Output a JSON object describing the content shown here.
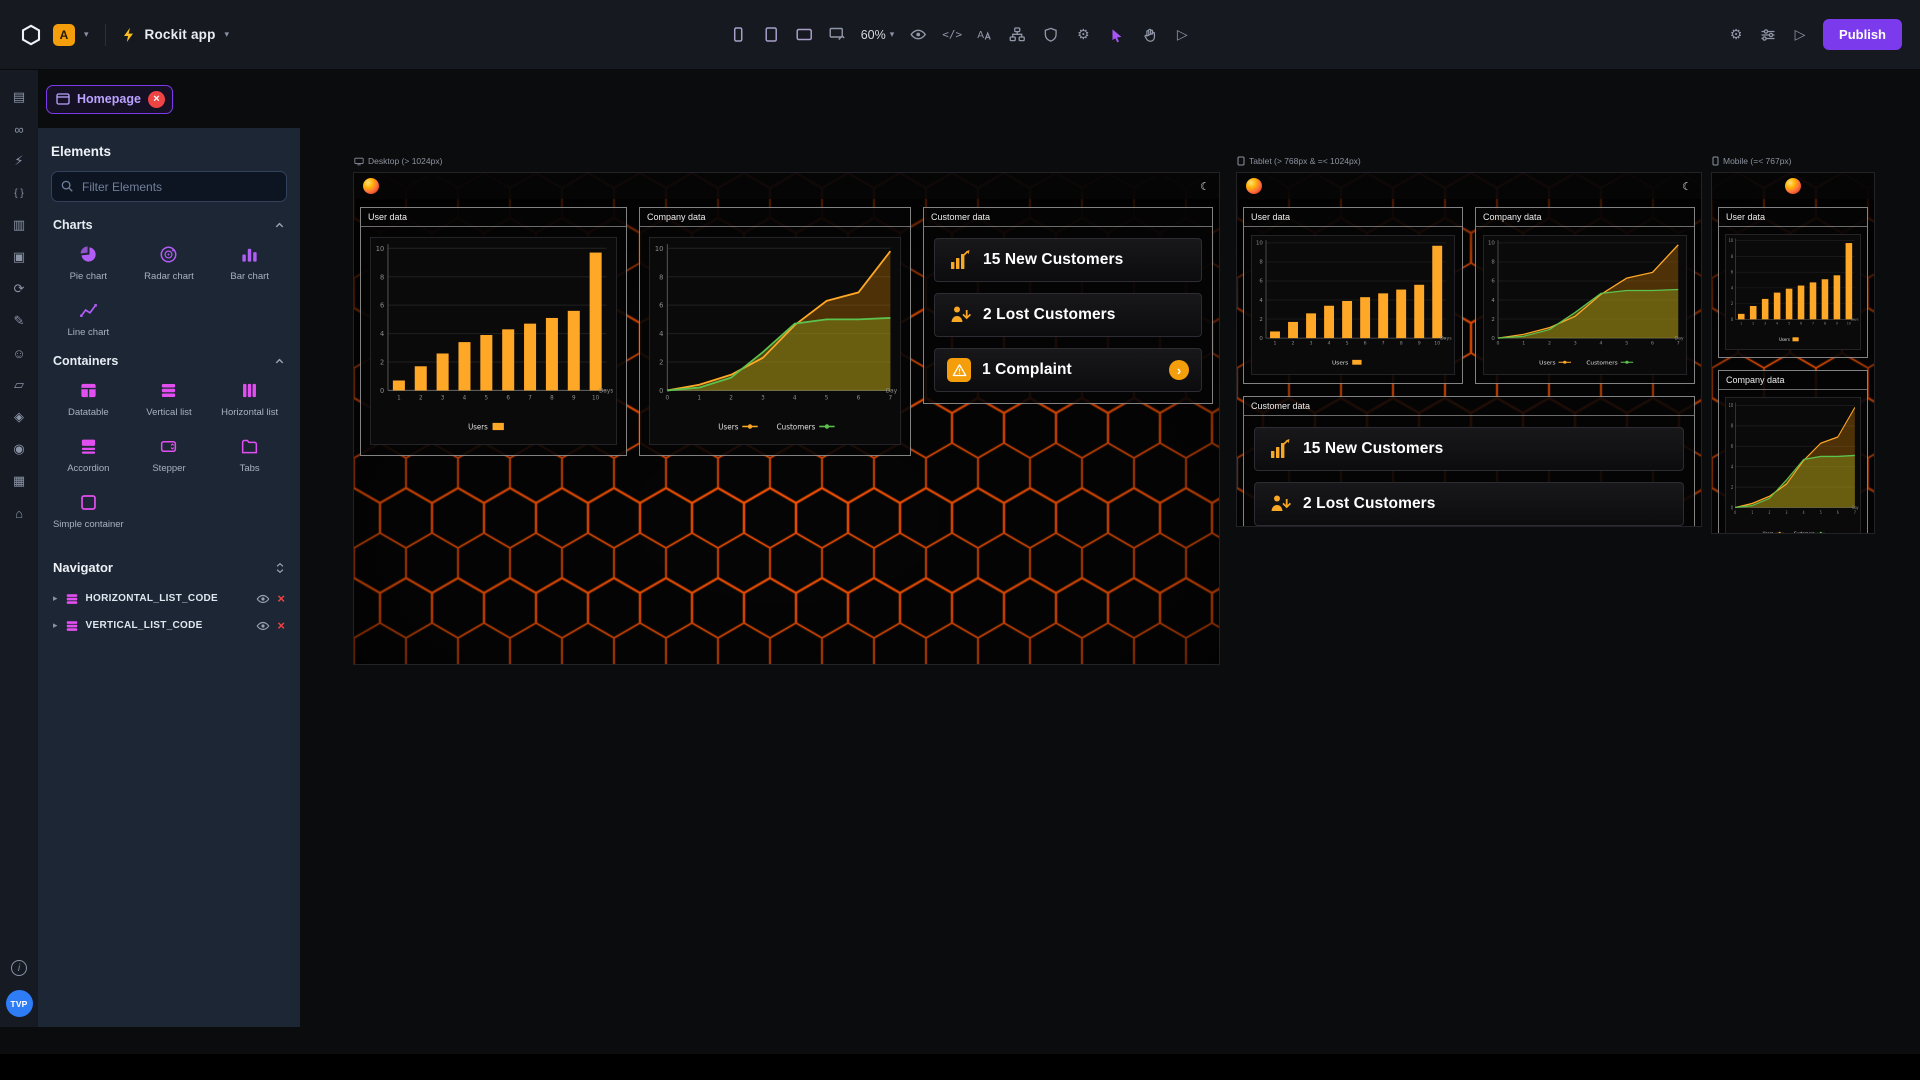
{
  "topbar": {
    "app_badge": "A",
    "app_name": "Rockit app",
    "zoom_level": "60%",
    "publish_label": "Publish",
    "code_icon_text": "</>"
  },
  "tab": {
    "label": "Homepage"
  },
  "elements_panel": {
    "title": "Elements",
    "filter_placeholder": "Filter Elements",
    "charts_section": {
      "title": "Charts",
      "items": [
        {
          "label": "Pie chart"
        },
        {
          "label": "Radar chart"
        },
        {
          "label": "Bar chart"
        },
        {
          "label": "Line chart"
        }
      ]
    },
    "containers_section": {
      "title": "Containers",
      "items": [
        {
          "label": "Datatable"
        },
        {
          "label": "Vertical list"
        },
        {
          "label": "Horizontal list"
        },
        {
          "label": "Accordion"
        },
        {
          "label": "Stepper"
        },
        {
          "label": "Tabs"
        },
        {
          "label": "Simple container"
        }
      ]
    },
    "navigator": {
      "title": "Navigator",
      "items": [
        {
          "label": "HORIZONTAL_LIST_CODE"
        },
        {
          "label": "VERTICAL_LIST_CODE"
        }
      ]
    }
  },
  "artboards": [
    {
      "label": "Desktop (> 1024px)"
    },
    {
      "label": "Tablet (> 768px & =< 1024px)"
    },
    {
      "label": "Mobile (=< 767px)"
    }
  ],
  "panels": {
    "user_data_title": "User data",
    "company_data_title": "Company data",
    "customer_data_title": "Customer data",
    "cards": [
      {
        "text": "15 New Customers"
      },
      {
        "text": "2 Lost Customers"
      },
      {
        "text": "1 Complaint"
      }
    ]
  },
  "user": {
    "initials": "TVP"
  },
  "icons": {
    "moon": "☾",
    "caret_down": "▾",
    "play": "▷",
    "gear": "⚙",
    "chevron_right": "›",
    "close_x": "×",
    "info": "i",
    "rail": [
      "▤",
      "∞",
      "⚡",
      "{ }",
      "▥",
      "▣",
      "⟳",
      "✎",
      "☺",
      "▱",
      "◈",
      "◉",
      "▦",
      "⌂"
    ]
  },
  "colors": {
    "accent_purple": "#7c3aed",
    "element_purple": "#b05ef5",
    "container_pink": "#e24ff0",
    "chart_orange": "#ffa726",
    "chart_green": "#5cc24e",
    "hex_orange": "#ff5400",
    "badge_orange": "#f59e0b",
    "danger_red": "#ef4444",
    "avatar_blue": "#2e7cf6"
  },
  "chart_data": [
    {
      "type": "bar",
      "title": "User data",
      "categories": [
        "1",
        "2",
        "3",
        "4",
        "5",
        "6",
        "7",
        "8",
        "9",
        "10"
      ],
      "values": [
        0.7,
        1.7,
        2.6,
        3.4,
        3.9,
        4.3,
        4.7,
        5.1,
        5.6,
        9.7
      ],
      "ylim": [
        0,
        10
      ],
      "yticks": [
        0,
        2,
        4,
        6,
        8,
        10
      ],
      "xlabel": "Days",
      "legend": [
        "Users"
      ],
      "color": "#ffa726"
    },
    {
      "type": "area",
      "title": "Company data",
      "x": [
        0,
        1,
        2,
        3,
        4,
        5,
        6,
        7
      ],
      "series": [
        {
          "name": "Users",
          "color": "#ffa726",
          "fill": "rgba(255,152,0,0.28)",
          "values": [
            0,
            0.4,
            1.1,
            2.3,
            4.6,
            6.3,
            6.9,
            9.8
          ]
        },
        {
          "name": "Customers",
          "color": "#5cc24e",
          "fill": "rgba(139,148,28,0.45)",
          "values": [
            0,
            0.2,
            0.9,
            2.7,
            4.7,
            5.0,
            5.0,
            5.1
          ]
        }
      ],
      "ylim": [
        0,
        10
      ],
      "yticks": [
        0,
        2,
        4,
        6,
        8,
        10
      ],
      "xlabel": "Day",
      "legend": [
        "Users",
        "Customers"
      ]
    }
  ]
}
